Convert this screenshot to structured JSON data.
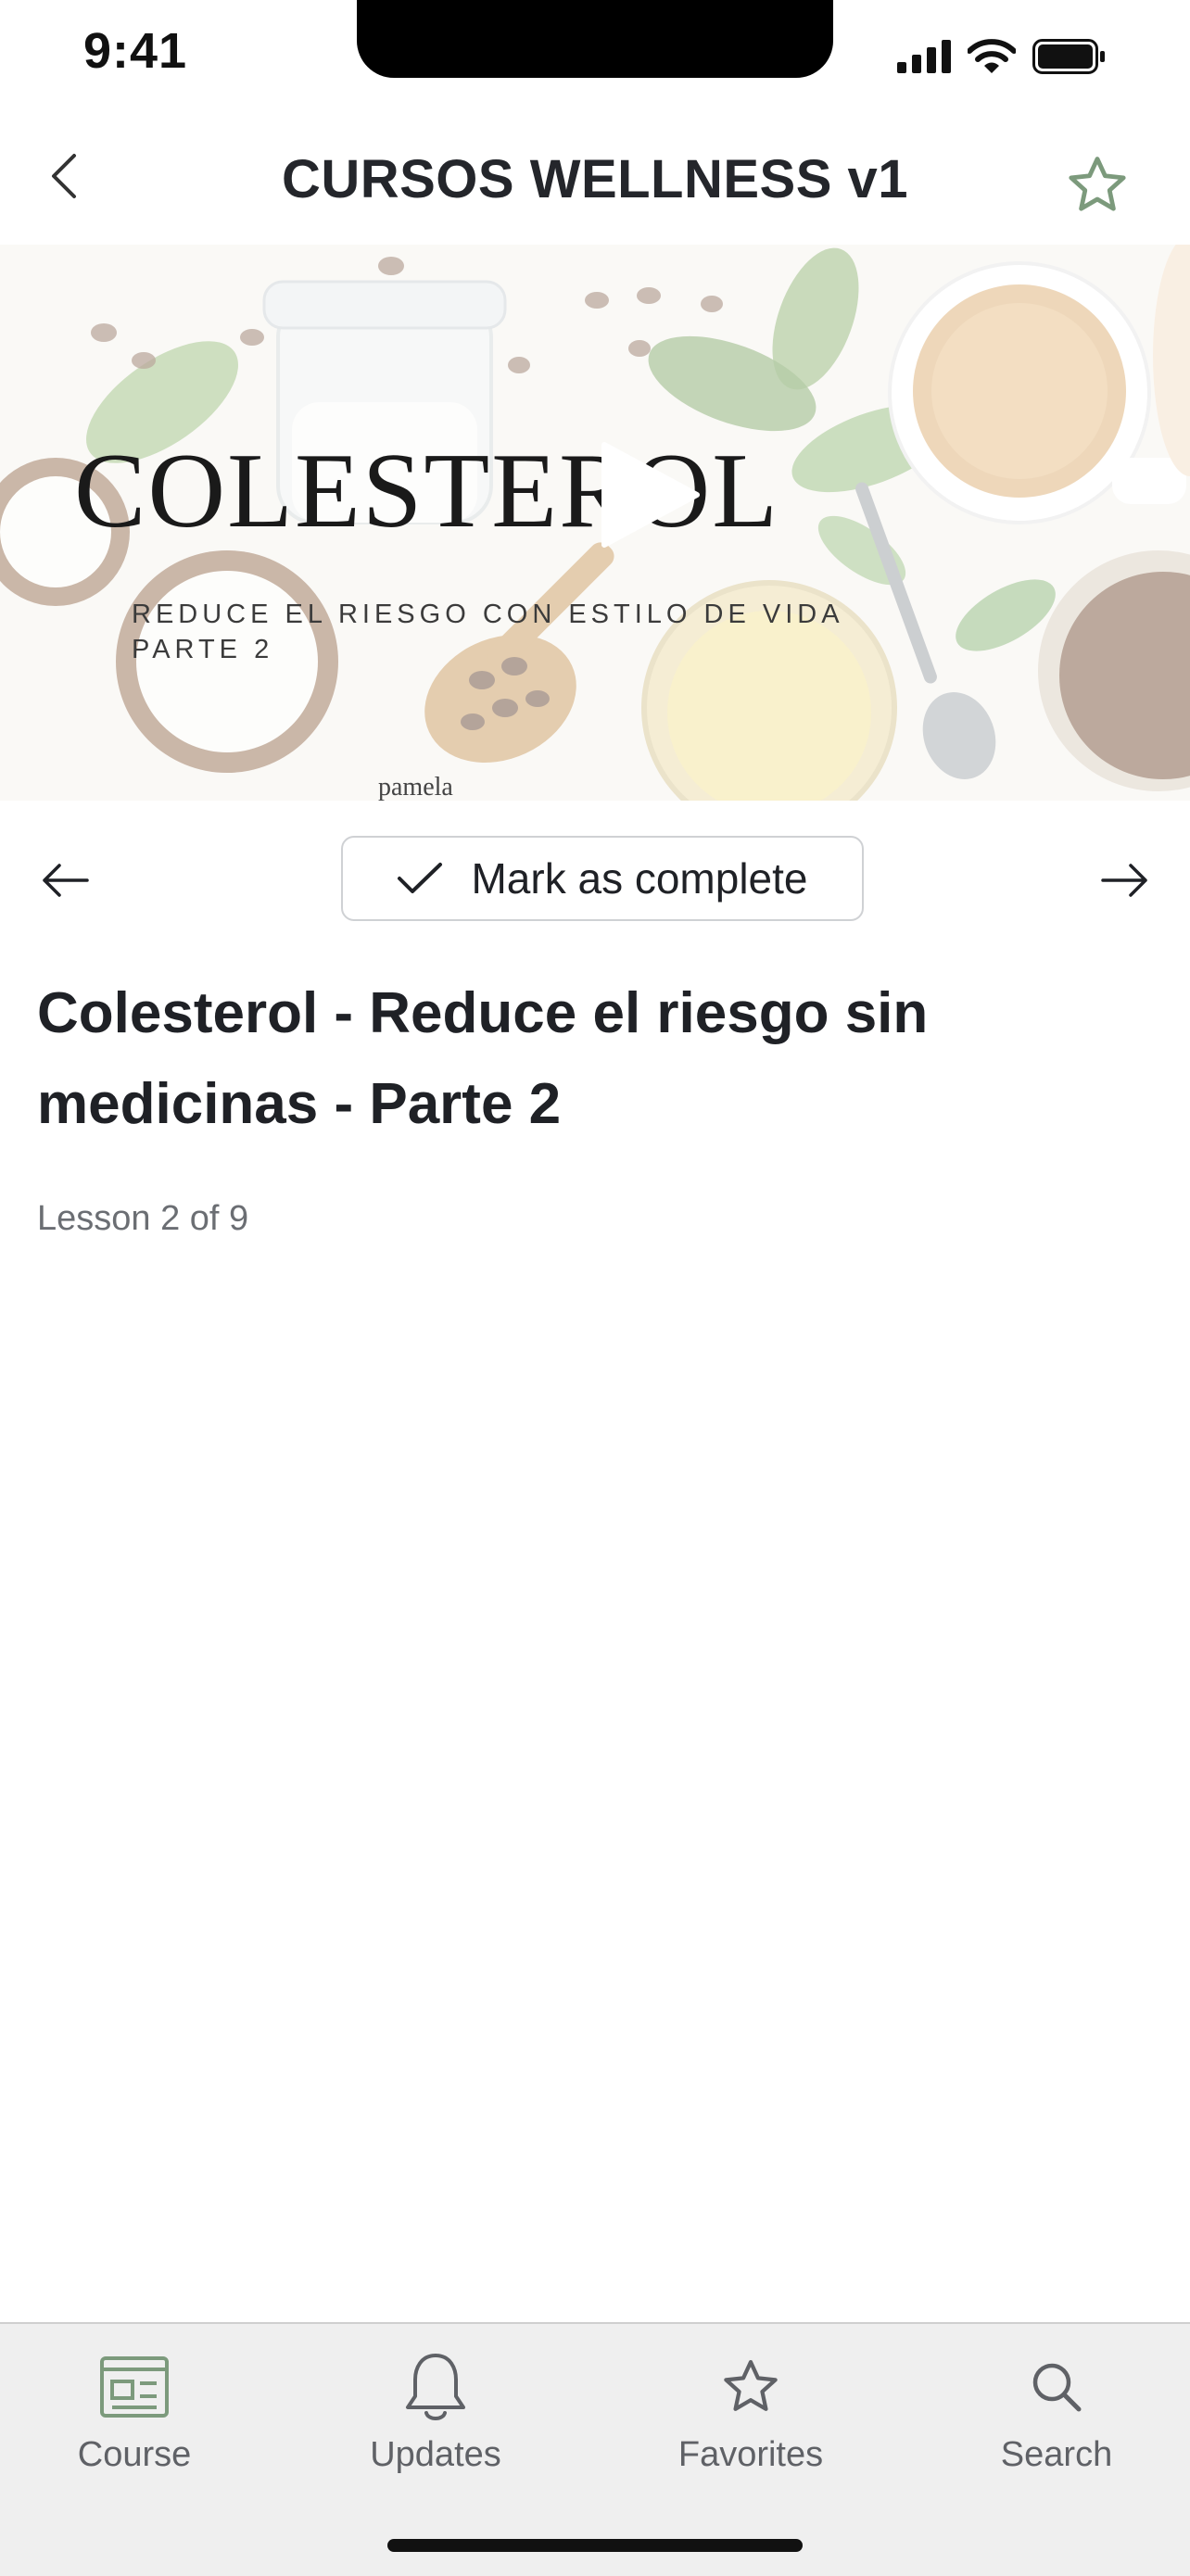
{
  "status_bar": {
    "time": "9:41"
  },
  "header": {
    "title": "CURSOS WELLNESS v1",
    "accent_color": "#7c9a7c"
  },
  "hero": {
    "title": "COLESTEROL",
    "subtitle_line1": "REDUCE EL RIESGO CON ESTILO DE VIDA",
    "subtitle_line2": "PARTE 2",
    "brand": "pamela"
  },
  "lesson": {
    "complete_label": "Mark as complete",
    "title": "Colesterol - Reduce el riesgo sin medicinas - Parte 2",
    "progress_text": "Lesson 2 of 9"
  },
  "tabs": [
    {
      "label": "Course",
      "icon": "course-icon",
      "active": true
    },
    {
      "label": "Updates",
      "icon": "bell-icon",
      "active": false
    },
    {
      "label": "Favorites",
      "icon": "star-icon",
      "active": false
    },
    {
      "label": "Search",
      "icon": "search-icon",
      "active": false
    }
  ]
}
